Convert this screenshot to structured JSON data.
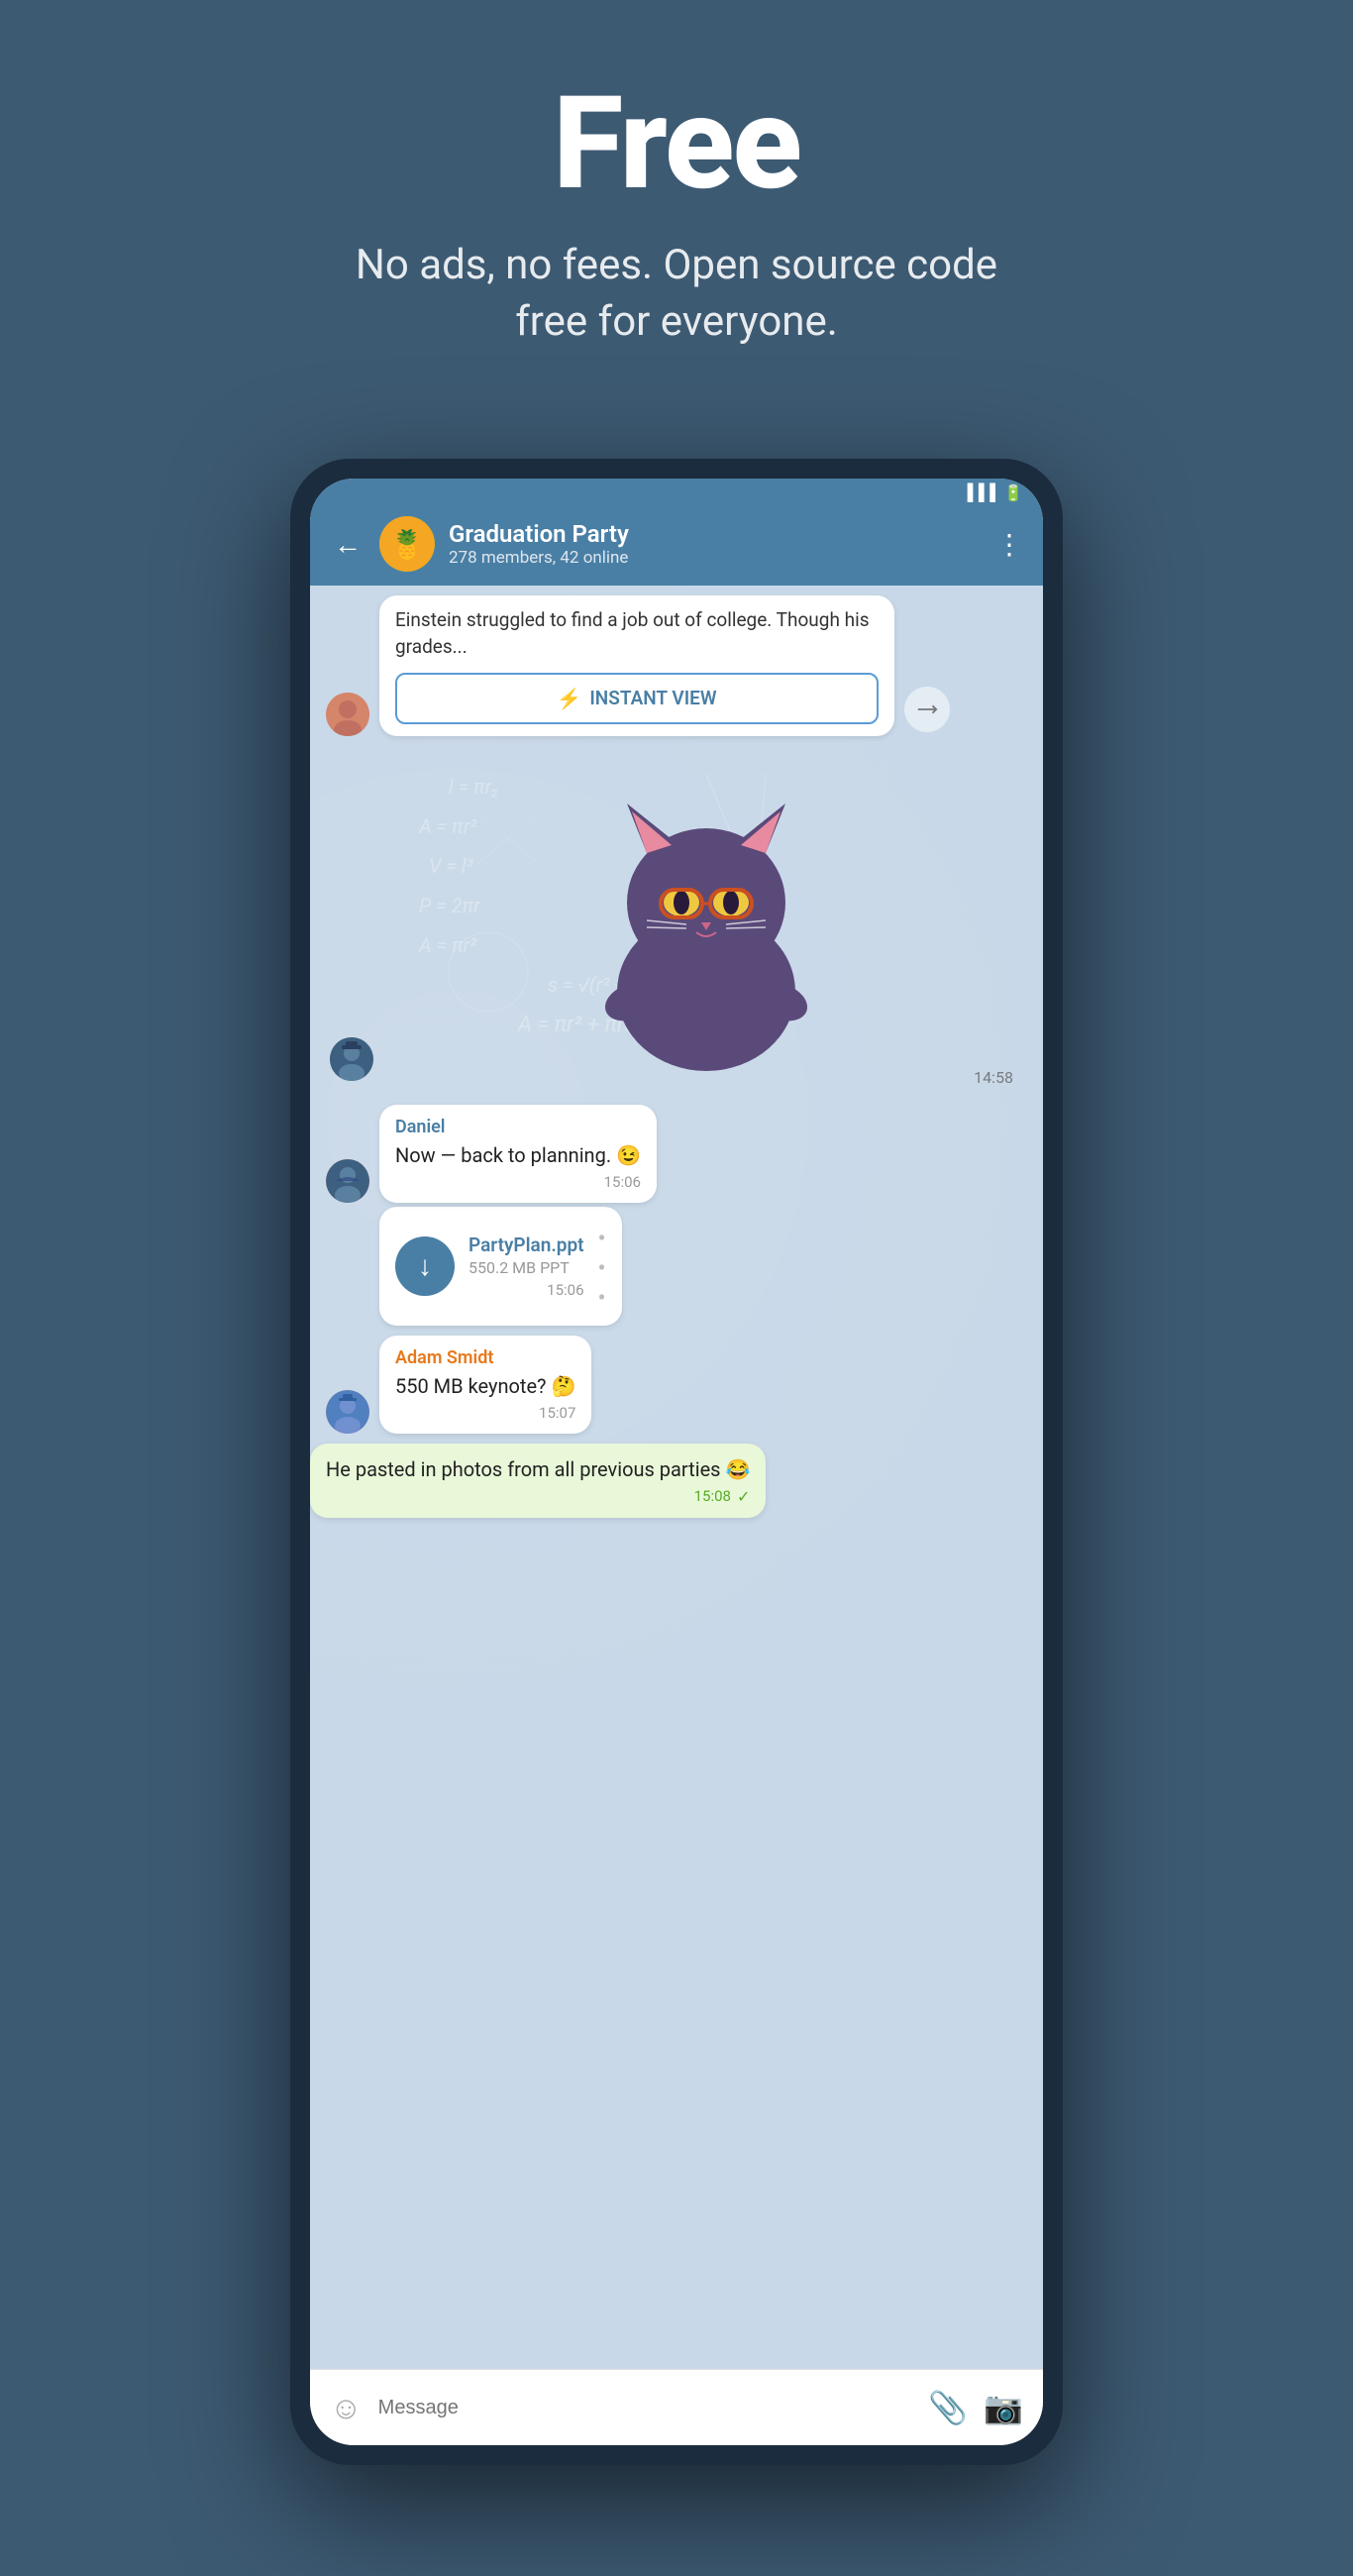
{
  "hero": {
    "title": "Free",
    "subtitle": "No ads, no fees. Open source code free for everyone."
  },
  "header": {
    "back_label": "←",
    "group_name": "Graduation Party",
    "group_members": "278 members, 42 online",
    "more_icon": "⋮"
  },
  "article": {
    "text": "Einstein struggled to find a job out of college. Though his grades...",
    "instant_view_label": "INSTANT VIEW",
    "lightning": "⚡"
  },
  "sticker": {
    "time": "14:58"
  },
  "messages": [
    {
      "sender": "Daniel",
      "text": "Now — back to planning. 😉",
      "time": "15:06",
      "type": "received"
    },
    {
      "file_name": "PartyPlan.ppt",
      "file_size": "550.2 MB PPT",
      "time": "15:06",
      "type": "file"
    },
    {
      "sender": "Adam Smidt",
      "text": "550 MB keynote? 🤔",
      "time": "15:07",
      "type": "received",
      "sender_color": "orange"
    },
    {
      "text": "He pasted in photos from all previous parties 😂",
      "time": "15:08",
      "type": "sent"
    }
  ],
  "input_bar": {
    "placeholder": "Message",
    "emoji_icon": "☺",
    "attach_icon": "📎",
    "camera_icon": "📷"
  },
  "math_formulas": [
    "l = πr₂",
    "A = πr²",
    "V = l³",
    "P = 2πr",
    "A = πr²",
    "s = √(r² + h²)",
    "A = πr² + πrs"
  ]
}
